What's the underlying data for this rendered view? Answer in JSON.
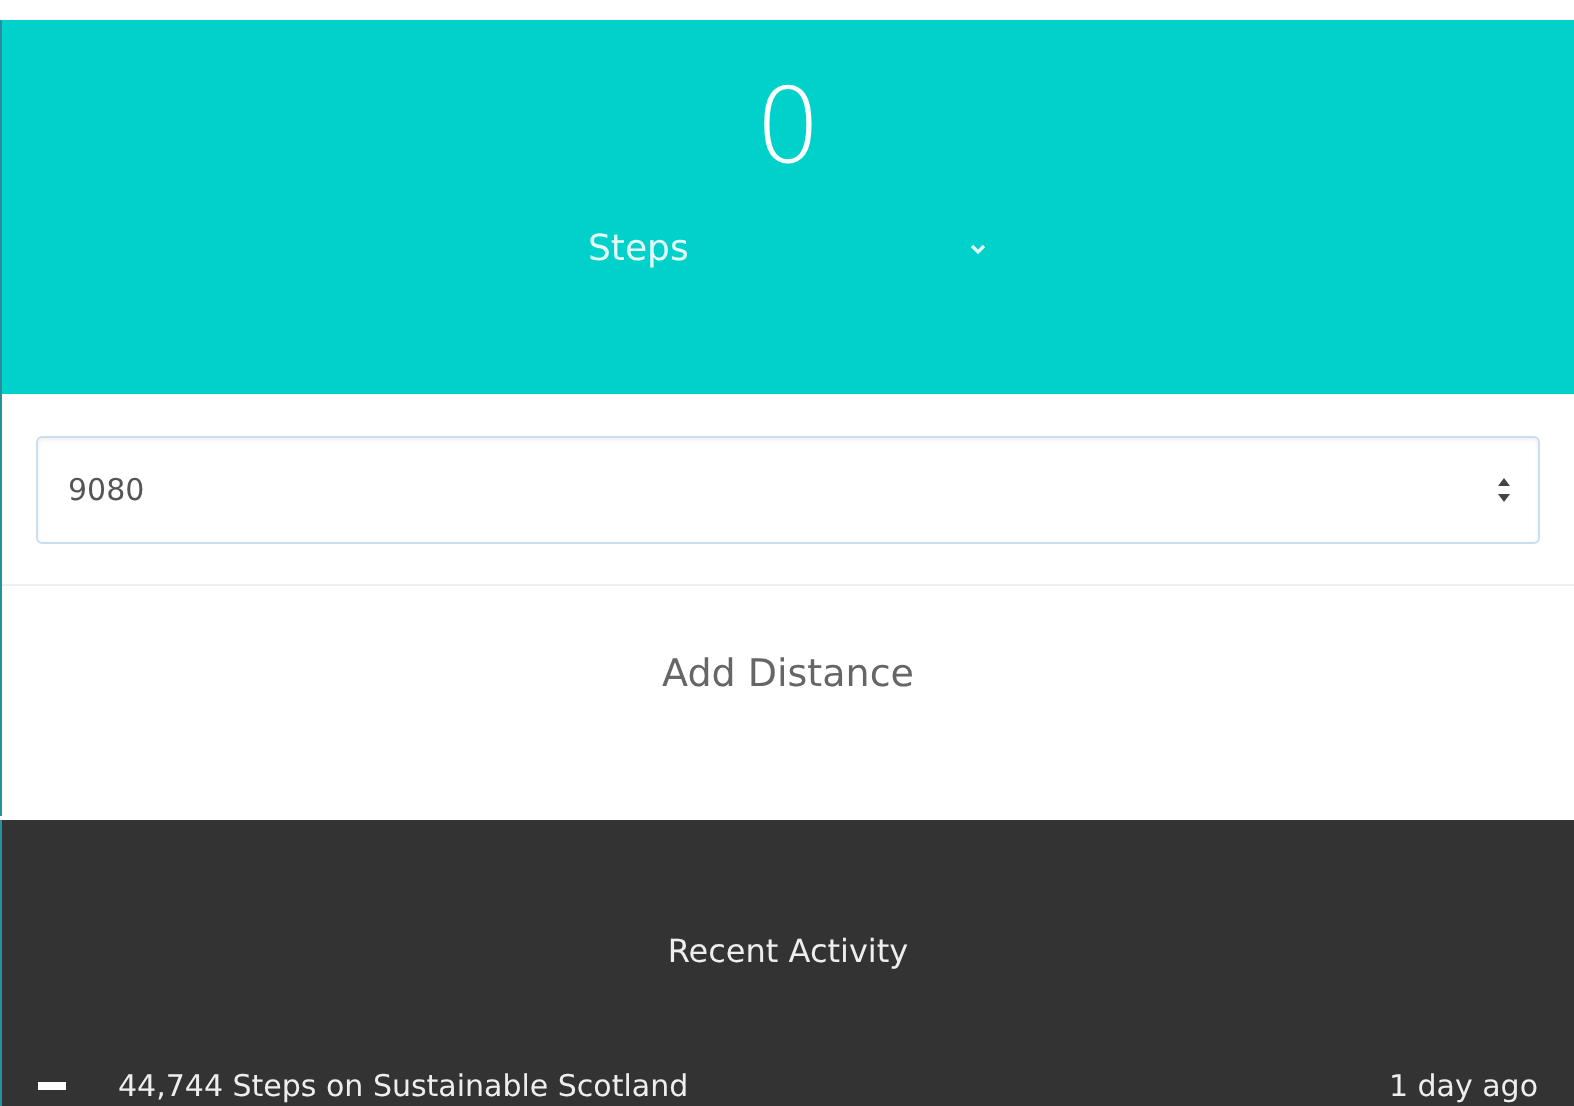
{
  "counter": {
    "value": "0",
    "unit": "Steps"
  },
  "form": {
    "value": "9080",
    "button": "Add Distance"
  },
  "activity": {
    "title": "Recent Activity",
    "items": [
      {
        "text": "44,744 Steps on Sustainable Scotland",
        "time": "1 day ago"
      }
    ]
  }
}
